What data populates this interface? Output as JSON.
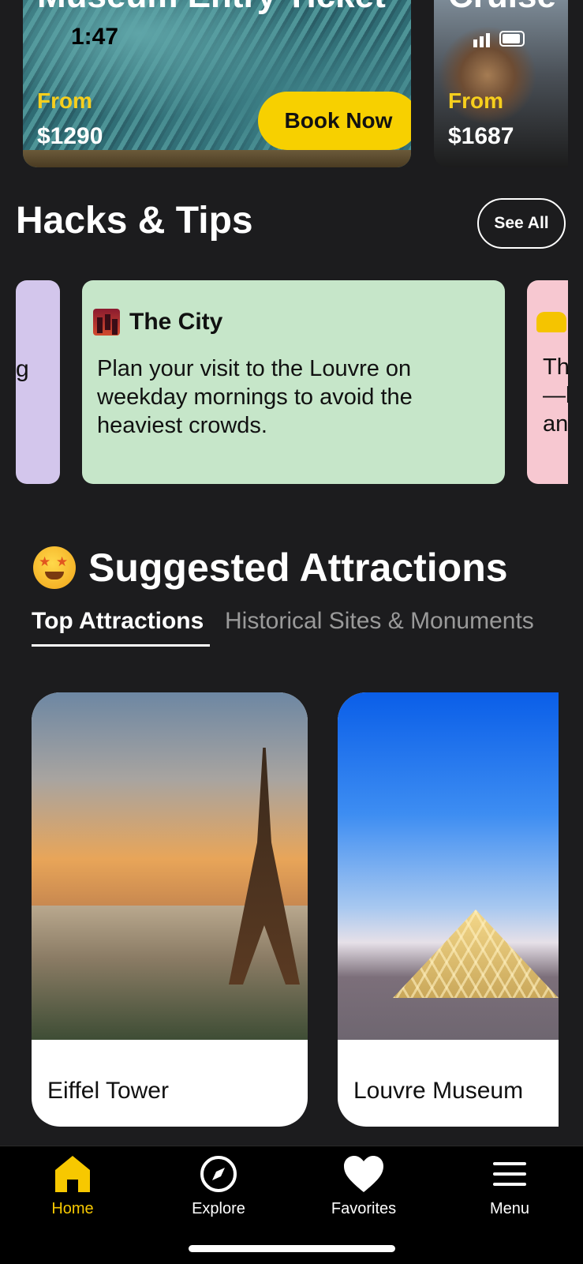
{
  "status_bar": {
    "time": "1:47"
  },
  "tickets": [
    {
      "title": "Museum Entry Ticket",
      "from_label": "From",
      "price": "$1290",
      "button": "Book Now"
    },
    {
      "title": "Cruise from th",
      "from_label": "From",
      "price": "$1687"
    }
  ],
  "hacks": {
    "title": "Hacks & Tips",
    "see_all": "See All",
    "cards": [
      {
        "partial_text": "g"
      },
      {
        "icon": "city-icon",
        "heading": "The City",
        "body": "Plan your visit to the Louvre on weekday mornings to avoid the heaviest crowds."
      },
      {
        "icon": "taxi-icon",
        "partial_text": "Th\n—l\nan"
      }
    ]
  },
  "suggested": {
    "icon": "star-struck-icon",
    "title": "Suggested Attractions",
    "tabs": [
      {
        "label": "Top Attractions",
        "active": true
      },
      {
        "label": "Historical Sites & Monuments",
        "active": false
      }
    ],
    "attractions": [
      {
        "name": "Eiffel Tower"
      },
      {
        "name": "Louvre Museum"
      }
    ]
  },
  "nav": {
    "items": [
      {
        "label": "Home",
        "icon": "home-icon",
        "active": true
      },
      {
        "label": "Explore",
        "icon": "compass-icon",
        "active": false
      },
      {
        "label": "Favorites",
        "icon": "heart-icon",
        "active": false
      },
      {
        "label": "Menu",
        "icon": "menu-icon",
        "active": false
      }
    ]
  },
  "colors": {
    "accent": "#f7d000",
    "background": "#1c1c1e"
  }
}
